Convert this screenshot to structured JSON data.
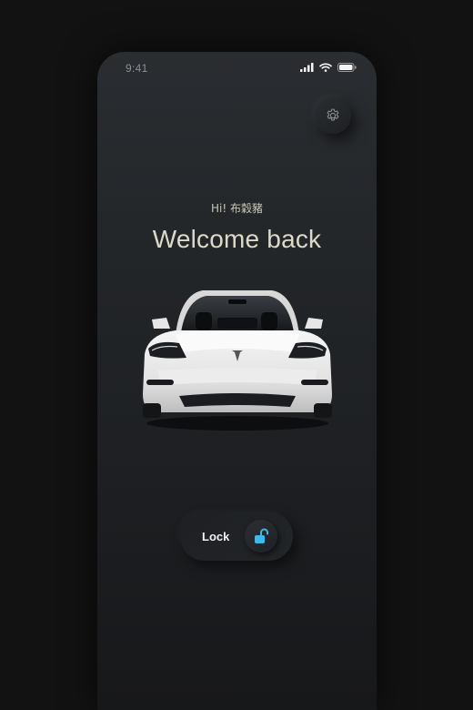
{
  "status_bar": {
    "time": "9:41",
    "signal_icon": "signal-bars-icon",
    "wifi_icon": "wifi-icon",
    "battery_icon": "battery-icon"
  },
  "header": {
    "settings_icon": "gear-icon"
  },
  "main": {
    "greeting": "Hi! 布穀豬",
    "title": "Welcome back",
    "car_image": "white-sedan-front-image"
  },
  "lock_control": {
    "label": "Lock",
    "icon": "unlocked-padlock-icon",
    "icon_color": "#3fb8e8"
  },
  "colors": {
    "page_bg": "#121212",
    "panel_bg": "#232629",
    "title_text": "#ddd9c8",
    "accent": "#3fb8e8"
  }
}
